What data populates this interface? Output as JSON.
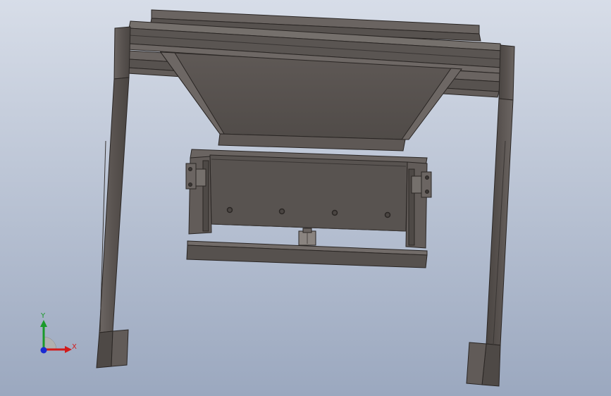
{
  "viewport": {
    "background_top": "#d5dbe6",
    "background_bottom": "#9aa6bd",
    "model_color": "#5a5552",
    "model_shadow": "#3a3634",
    "model_highlight": "#7d7874",
    "edge_color": "#2a2624"
  },
  "triad": {
    "x_label": "X",
    "y_label": "Y",
    "x_color": "#d21a1a",
    "y_color": "#1a9a2a",
    "z_color": "#1a2ad2"
  }
}
